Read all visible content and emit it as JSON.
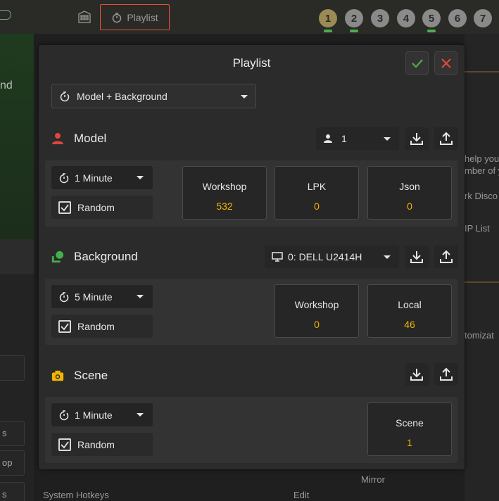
{
  "topbar": {
    "playlist_tab": "Playlist",
    "numbers": [
      "1",
      "2",
      "3",
      "4",
      "5",
      "6",
      "7"
    ]
  },
  "background_app": {
    "left_text": "nd",
    "left_items": [
      "s",
      "op",
      "s"
    ],
    "right_items": [
      "help you",
      "mber of y",
      "rk Disco",
      "IP List",
      "tomizat"
    ],
    "bottom_left": "System Hotkeys",
    "bottom_edit": "Edit",
    "bottom_right": "Mirror"
  },
  "modal": {
    "title": "Playlist",
    "mode": "Model + Background",
    "model": {
      "label": "Model",
      "count_select": "1",
      "timer": "1 Minute",
      "random": "Random",
      "stats": [
        {
          "label": "Workshop",
          "value": "532"
        },
        {
          "label": "LPK",
          "value": "0"
        },
        {
          "label": "Json",
          "value": "0"
        }
      ]
    },
    "background": {
      "label": "Background",
      "monitor_select": "0: DELL U2414H",
      "timer": "5 Minute",
      "random": "Random",
      "stats": [
        {
          "label": "Workshop",
          "value": "0"
        },
        {
          "label": "Local",
          "value": "46"
        }
      ]
    },
    "scene": {
      "label": "Scene",
      "timer": "1 Minute",
      "random": "Random",
      "stats": [
        {
          "label": "Scene",
          "value": "1"
        }
      ]
    }
  },
  "colors": {
    "accent_green": "#4caf50",
    "accent_red": "#e04a3a",
    "value_yellow": "#f2b400",
    "model_icon": "#e0463a",
    "background_icon": "#43b14a",
    "scene_icon": "#f2b400"
  }
}
